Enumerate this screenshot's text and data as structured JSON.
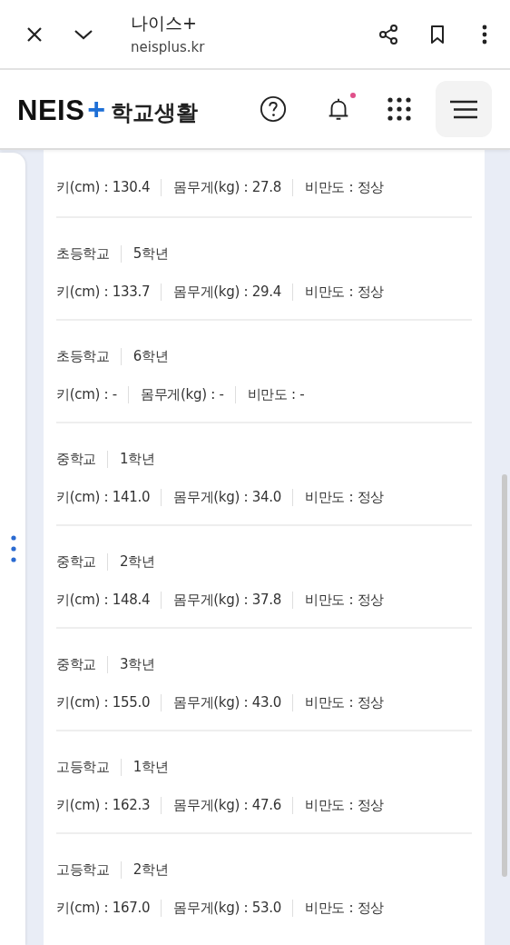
{
  "browser_bar": {
    "title": "나이스+",
    "url": "neisplus.kr"
  },
  "app_header": {
    "logo": {
      "name": "NEIS",
      "plus": "+",
      "section": "학교생활"
    },
    "notification_unread": true
  },
  "records": [
    {
      "metrics": [
        "키(cm) : 130.4",
        "몸무게(kg) : 27.8",
        "비만도 : 정상"
      ]
    },
    {
      "school": "초등학교",
      "grade": "5학년",
      "metrics": [
        "키(cm) : 133.7",
        "몸무게(kg) : 29.4",
        "비만도 : 정상"
      ]
    },
    {
      "school": "초등학교",
      "grade": "6학년",
      "metrics": [
        "키(cm) : -",
        "몸무게(kg) : -",
        "비만도 : -"
      ]
    },
    {
      "school": "중학교",
      "grade": "1학년",
      "metrics": [
        "키(cm) : 141.0",
        "몸무게(kg) : 34.0",
        "비만도 : 정상"
      ]
    },
    {
      "school": "중학교",
      "grade": "2학년",
      "metrics": [
        "키(cm) : 148.4",
        "몸무게(kg) : 37.8",
        "비만도 : 정상"
      ]
    },
    {
      "school": "중학교",
      "grade": "3학년",
      "metrics": [
        "키(cm) : 155.0",
        "몸무게(kg) : 43.0",
        "비만도 : 정상"
      ]
    },
    {
      "school": "고등학교",
      "grade": "1학년",
      "metrics": [
        "키(cm) : 162.3",
        "몸무게(kg) : 47.6",
        "비만도 : 정상"
      ]
    },
    {
      "school": "고등학교",
      "grade": "2학년",
      "metrics": [
        "키(cm) : 167.0",
        "몸무게(kg) : 53.0",
        "비만도 : 정상"
      ]
    }
  ]
}
